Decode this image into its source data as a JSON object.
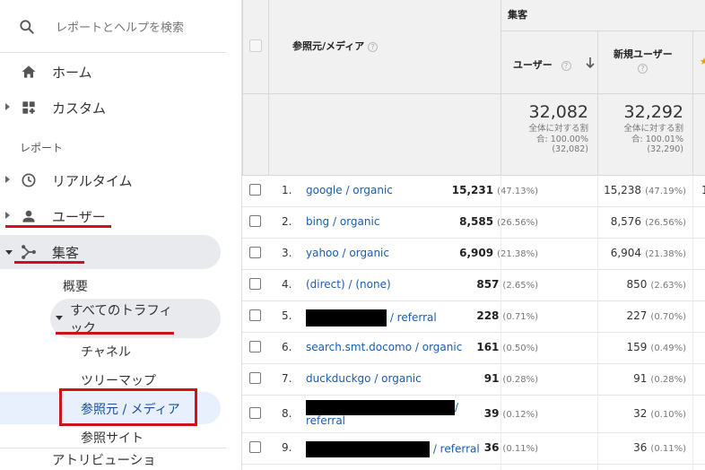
{
  "search": {
    "placeholder": "レポートとヘルプを検索"
  },
  "nav": {
    "home": "ホーム",
    "custom": "カスタム",
    "section_reports": "レポート",
    "realtime": "リアルタイム",
    "audience": "ユーザー",
    "acquisition": "集客",
    "overview": "概要",
    "all_traffic_line1": "すべてのトラフィ",
    "all_traffic_line2": "ック",
    "channels": "チャネル",
    "treemap": "ツリーマップ",
    "source_medium": "参照元 / メディア",
    "referrals": "参照サイト",
    "attribution": "アトリビューショ"
  },
  "table": {
    "group_header": "集客",
    "col_source": "参照元/メディア",
    "col_users": "ユーザー",
    "col_new_users": "新規ユーザー",
    "totals": {
      "users": "32,082",
      "users_sub1": "全体に対する割",
      "users_sub2": "合: 100.00%",
      "users_sub3": "(32,082)",
      "new_users": "32,292",
      "new_sub1": "全体に対する割",
      "new_sub2": "合: 100.01%",
      "new_sub3": "(32,290)"
    },
    "rows": [
      {
        "num": "1.",
        "source": "google / organic",
        "users": "15,231",
        "users_pct": "(47.13%)",
        "new_users": "15,238",
        "new_pct": "(47.19%)"
      },
      {
        "num": "2.",
        "source": "bing / organic",
        "users": "8,585",
        "users_pct": "(26.56%)",
        "new_users": "8,576",
        "new_pct": "(26.56%)"
      },
      {
        "num": "3.",
        "source": "yahoo / organic",
        "users": "6,909",
        "users_pct": "(21.38%)",
        "new_users": "6,904",
        "new_pct": "(21.38%)"
      },
      {
        "num": "4.",
        "source": "(direct) / (none)",
        "users": "857",
        "users_pct": "(2.65%)",
        "new_users": "850",
        "new_pct": "(2.63%)"
      },
      {
        "num": "5.",
        "source": "/ referral",
        "users": "228",
        "users_pct": "(0.71%)",
        "new_users": "227",
        "new_pct": "(0.70%)"
      },
      {
        "num": "6.",
        "source": "search.smt.docomo / organic",
        "users": "161",
        "users_pct": "(0.50%)",
        "new_users": "159",
        "new_pct": "(0.49%)"
      },
      {
        "num": "7.",
        "source": "duckduckgo / organic",
        "users": "91",
        "users_pct": "(0.28%)",
        "new_users": "91",
        "new_pct": "(0.28%)"
      },
      {
        "num": "8.",
        "source_line1": "/",
        "source_line2": "referral",
        "users": "39",
        "users_pct": "(0.12%)",
        "new_users": "32",
        "new_pct": "(0.10%)"
      },
      {
        "num": "9.",
        "source": "/ referral",
        "users": "36",
        "users_pct": "(0.11%)",
        "new_users": "36",
        "new_pct": "(0.11%)"
      }
    ],
    "clipped_col_char": "1"
  },
  "colors": {
    "highlight_red": "#d0111b",
    "link_blue": "#1a5dad",
    "active_bg": "#e8f0fe"
  }
}
